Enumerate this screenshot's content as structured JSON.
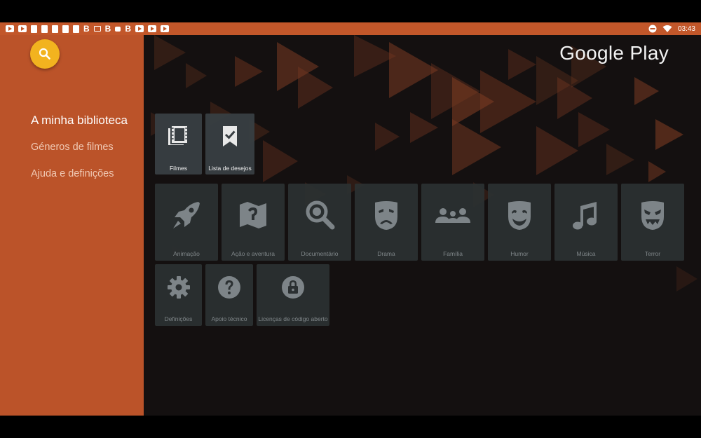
{
  "status_bar": {
    "bg_color": "#c2572a",
    "notification_icons": [
      "youtube-icon",
      "youtube-icon",
      "document-icon",
      "document-icon",
      "document-icon",
      "document-icon",
      "document-icon",
      "b-icon",
      "cast-icon",
      "b-icon",
      "bag-icon",
      "b-icon",
      "youtube-icon",
      "youtube-icon",
      "youtube-icon"
    ],
    "b_letter": "B",
    "time": "03:43"
  },
  "sidebar": {
    "bg_color": "#bb5329",
    "search_color": "#f2b31f",
    "items": [
      {
        "label": "A minha biblioteca",
        "active": true
      },
      {
        "label": "Géneros de filmes",
        "active": false
      },
      {
        "label": "Ajuda e definições",
        "active": false
      }
    ]
  },
  "logo": {
    "text": "Google Play"
  },
  "library_tiles": [
    {
      "label": "Filmes",
      "icon": "film-icon"
    },
    {
      "label": "Lista de desejos",
      "icon": "bookmark-check-icon"
    }
  ],
  "genre_tiles": [
    {
      "label": "Animação",
      "icon": "rocket-icon"
    },
    {
      "label": "Ação e aventura",
      "icon": "map-icon"
    },
    {
      "label": "Documentário",
      "icon": "magnifier-icon"
    },
    {
      "label": "Drama",
      "icon": "sad-mask-icon"
    },
    {
      "label": "Família",
      "icon": "people-icon"
    },
    {
      "label": "Humor",
      "icon": "happy-mask-icon"
    },
    {
      "label": "Música",
      "icon": "music-note-icon"
    },
    {
      "label": "Terror",
      "icon": "scary-mask-icon"
    }
  ],
  "help_tiles": [
    {
      "label": "Definições",
      "icon": "gear-icon"
    },
    {
      "label": "Apoio técnico",
      "icon": "question-icon"
    },
    {
      "label": "Licenças de código aberto",
      "icon": "lock-icon"
    }
  ]
}
